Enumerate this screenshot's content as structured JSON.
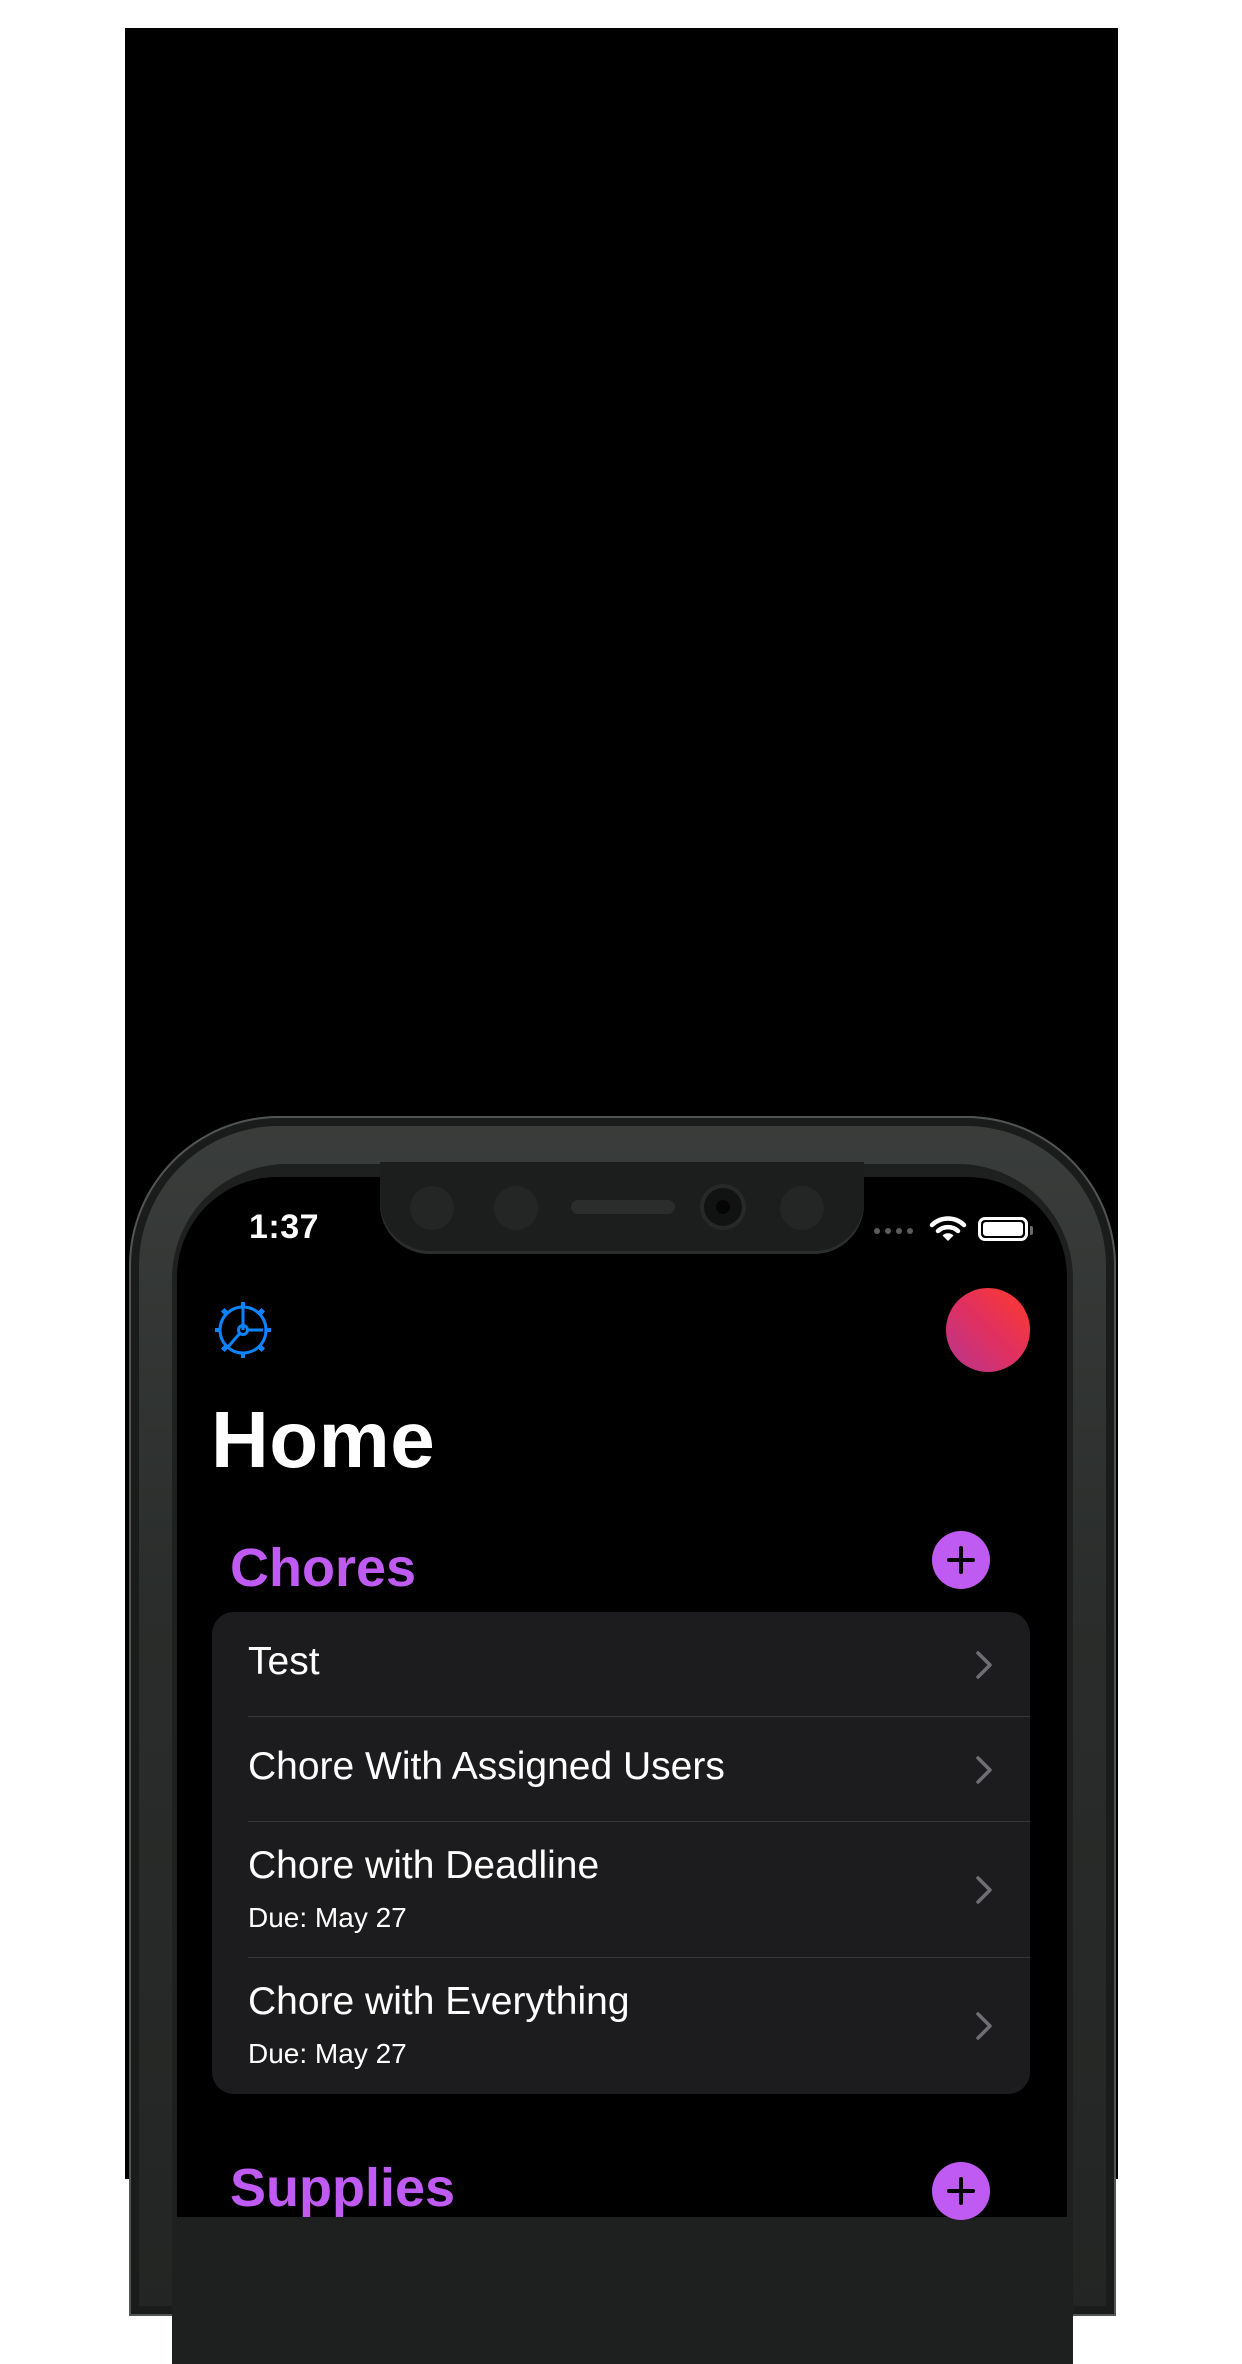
{
  "status_bar": {
    "time": "1:37",
    "icons": [
      "cellular-signal-icon",
      "wifi-icon",
      "battery-icon"
    ]
  },
  "toolbar": {
    "settings_icon": "gear-icon",
    "avatar": "profile-avatar"
  },
  "page": {
    "title": "Home"
  },
  "chores": {
    "section_title": "Chores",
    "add_icon": "plus-circle-icon",
    "items": [
      {
        "title": "Test",
        "subtitle": ""
      },
      {
        "title": "Chore With Assigned Users",
        "subtitle": ""
      },
      {
        "title": "Chore with Deadline",
        "subtitle": "Due: May 27"
      },
      {
        "title": "Chore with Everything",
        "subtitle": "Due: May 27"
      }
    ]
  },
  "supplies": {
    "section_title": "Supplies",
    "add_icon": "plus-circle-icon"
  },
  "colors": {
    "accent_purple": "#bf5af2",
    "settings_blue": "#0a84ff",
    "card_bg": "#1c1c1e",
    "screen_bg": "#000000"
  }
}
